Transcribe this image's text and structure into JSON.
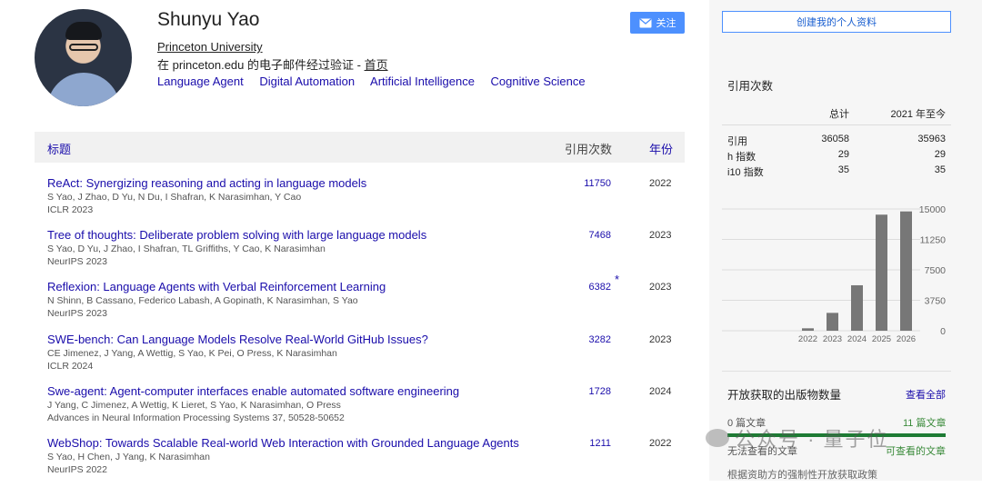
{
  "profile": {
    "name": "Shunyu Yao",
    "affiliation": "Princeton University",
    "verified_text": "在 princeton.edu 的电子邮件经过验证 - ",
    "homepage_label": "首页",
    "interests": [
      "Language Agent",
      "Digital Automation",
      "Artificial Intelligence",
      "Cognitive Science"
    ]
  },
  "actions": {
    "follow_label": "关注",
    "create_profile_label": "创建我的个人资料"
  },
  "table": {
    "headers": {
      "title": "标题",
      "citations": "引用次数",
      "year": "年份"
    },
    "rows": [
      {
        "title": "ReAct: Synergizing reasoning and acting in language models",
        "authors": "S Yao, J Zhao, D Yu, N Du, I Shafran, K Narasimhan, Y Cao",
        "venue": "ICLR 2023",
        "citations": "11750",
        "star": "",
        "year": "2022"
      },
      {
        "title": "Tree of thoughts: Deliberate problem solving with large language models",
        "authors": "S Yao, D Yu, J Zhao, I Shafran, TL Griffiths, Y Cao, K Narasimhan",
        "venue": "NeurIPS 2023",
        "citations": "7468",
        "star": "",
        "year": "2023"
      },
      {
        "title": "Reflexion: Language Agents with Verbal Reinforcement Learning",
        "authors": "N Shinn, B Cassano, Federico Labash, A Gopinath, K Narasimhan, S Yao",
        "venue": "NeurIPS 2023",
        "citations": "6382",
        "star": "*",
        "year": "2023"
      },
      {
        "title": "SWE-bench: Can Language Models Resolve Real-World GitHub Issues?",
        "authors": "CE Jimenez, J Yang, A Wettig, S Yao, K Pei, O Press, K Narasimhan",
        "venue": "ICLR 2024",
        "citations": "3282",
        "star": "",
        "year": "2023"
      },
      {
        "title": "Swe-agent: Agent-computer interfaces enable automated software engineering",
        "authors": "J Yang, C Jimenez, A Wettig, K Lieret, S Yao, K Narasimhan, O Press",
        "venue": "Advances in Neural Information Processing Systems 37, 50528-50652",
        "citations": "1728",
        "star": "",
        "year": "2024"
      },
      {
        "title": "WebShop: Towards Scalable Real-world Web Interaction with Grounded Language Agents",
        "authors": "S Yao, H Chen, J Yang, K Narasimhan",
        "venue": "NeurIPS 2022",
        "citations": "1211",
        "star": "",
        "year": "2022"
      }
    ]
  },
  "cited_by": {
    "title": "引用次数",
    "col_all": "总计",
    "col_since": "2021 年至今",
    "rows": [
      {
        "label": "引用",
        "all": "36058",
        "since": "35963"
      },
      {
        "label": "h 指数",
        "all": "29",
        "since": "29"
      },
      {
        "label": "i10 指数",
        "all": "35",
        "since": "35"
      }
    ]
  },
  "chart_data": {
    "type": "bar",
    "categories": [
      "2022",
      "2023",
      "2024",
      "2025",
      "2026"
    ],
    "values": [
      300,
      2200,
      5600,
      14300,
      14700
    ],
    "y_ticks": [
      "15000",
      "11250",
      "7500",
      "3750",
      "0"
    ],
    "ylim": [
      0,
      15000
    ],
    "grid": true,
    "bar_color": "#777777"
  },
  "open_access": {
    "title": "开放获取的出版物数量",
    "view_all": "查看全部",
    "left_count": "0 篇文章",
    "right_count": "11 篇文章",
    "left_status": "无法查看的文章",
    "right_status": "可查看的文章",
    "policy": "根据资助方的强制性开放获取政策",
    "available_fraction": 1.0
  },
  "watermark": {
    "text": "公众号 · 量子位"
  }
}
